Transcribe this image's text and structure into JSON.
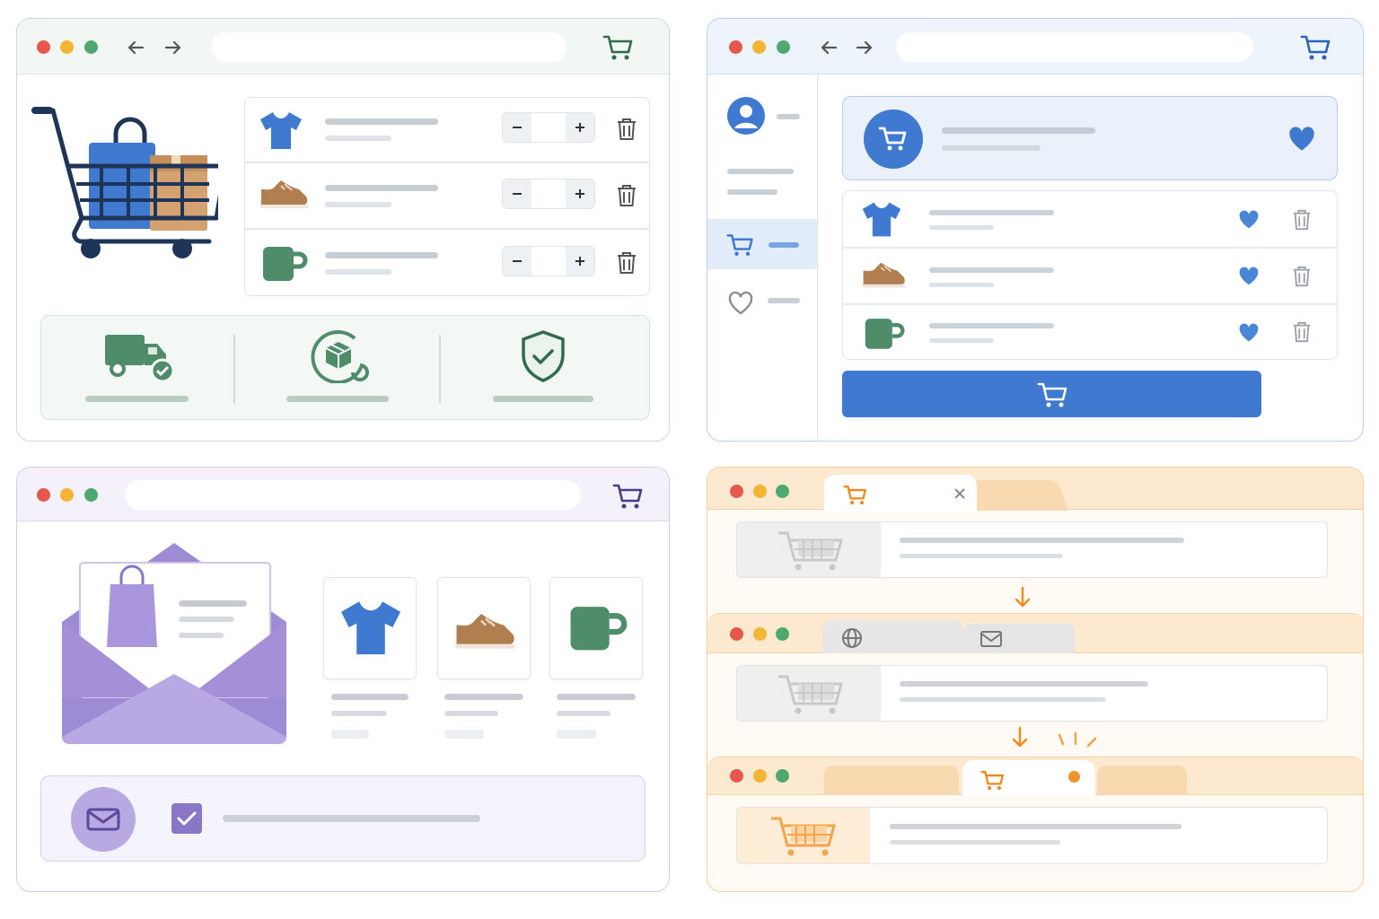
{
  "colors": {
    "green_accent": "#4e8c6a",
    "navy": "#1f3557",
    "blue_accent": "#4a80cc",
    "purple_accent": "#8a76c6",
    "orange_accent": "#f0a040",
    "traffic_red": "#e5584b",
    "traffic_yellow": "#f3b534",
    "traffic_green": "#4ea872"
  },
  "panels": [
    {
      "id": "cart-panel",
      "theme": "green",
      "icons": [
        "back-arrow-icon",
        "forward-arrow-icon",
        "cart-icon"
      ],
      "cart_items": [
        {
          "icon": "tshirt-icon"
        },
        {
          "icon": "shoe-icon"
        },
        {
          "icon": "mug-icon"
        }
      ],
      "features": [
        "delivery-truck-icon",
        "returns-box-icon",
        "security-shield-icon"
      ]
    },
    {
      "id": "wishlist-panel",
      "theme": "blue",
      "sidebar": [
        "profile-icon",
        "cart-icon",
        "heart-icon"
      ],
      "wishlist_items": [
        {
          "icon": "tshirt-icon",
          "favorited": true
        },
        {
          "icon": "shoe-icon",
          "favorited": true
        },
        {
          "icon": "mug-icon",
          "favorited": true
        }
      ],
      "action": "add-to-cart-button"
    },
    {
      "id": "email-panel",
      "theme": "purple",
      "products": [
        "tshirt-icon",
        "shoe-icon",
        "mug-icon"
      ],
      "subscribe_checked": true
    },
    {
      "id": "tab-recovery-panel",
      "theme": "orange",
      "stages": [
        "cart-tab-open",
        "other-tabs",
        "cart-tab-notification"
      ]
    }
  ]
}
